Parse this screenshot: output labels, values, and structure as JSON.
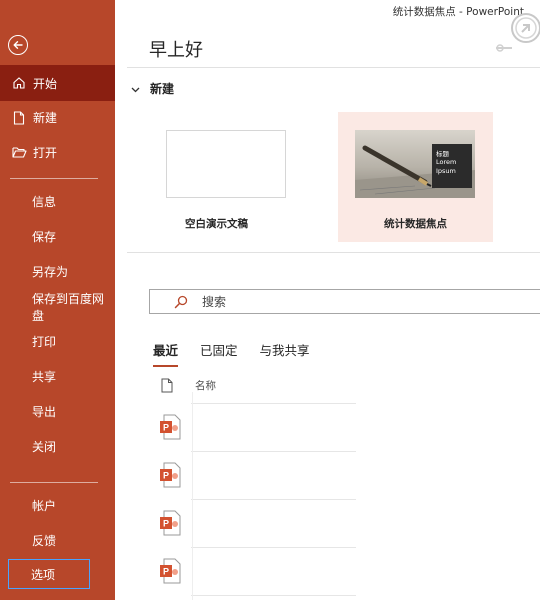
{
  "window": {
    "title": "统计数据焦点 - PowerPoint"
  },
  "sidebar": {
    "back_icon": "back-arrow-circle-icon",
    "top_items": [
      {
        "label": "开始",
        "icon": "home-icon",
        "active": true
      },
      {
        "label": "新建",
        "icon": "new-document-icon"
      },
      {
        "label": "打开",
        "icon": "folder-open-icon"
      }
    ],
    "middle_items": [
      {
        "label": "信息"
      },
      {
        "label": "保存"
      },
      {
        "label": "另存为"
      },
      {
        "label": "保存到百度网盘"
      },
      {
        "label": "打印"
      },
      {
        "label": "共享"
      },
      {
        "label": "导出"
      },
      {
        "label": "关闭"
      }
    ],
    "bottom_items": [
      {
        "label": "帐户"
      },
      {
        "label": "反馈"
      },
      {
        "label": "选项",
        "focused": true
      }
    ],
    "colors": {
      "background": "#b7472a",
      "active": "#8a1f11",
      "focus_border": "#4aa3ff"
    }
  },
  "main": {
    "greeting": "早上好",
    "new_section": {
      "title": "新建",
      "chevron": "chevron-down-icon"
    },
    "templates": [
      {
        "label": "空白演示文稿",
        "type": "blank"
      },
      {
        "label": "统计数据焦点",
        "type": "photo",
        "selected": true,
        "thumb_text": "标题 Lorem Ipsum"
      }
    ],
    "search": {
      "placeholder": "搜索",
      "icon": "search-icon"
    },
    "tabs": [
      {
        "label": "最近",
        "active": true
      },
      {
        "label": "已固定"
      },
      {
        "label": "与我共享"
      }
    ],
    "list": {
      "header_icon": "file-icon",
      "name_header": "名称",
      "file_icon": "powerpoint-file-icon",
      "rows": 4
    }
  }
}
